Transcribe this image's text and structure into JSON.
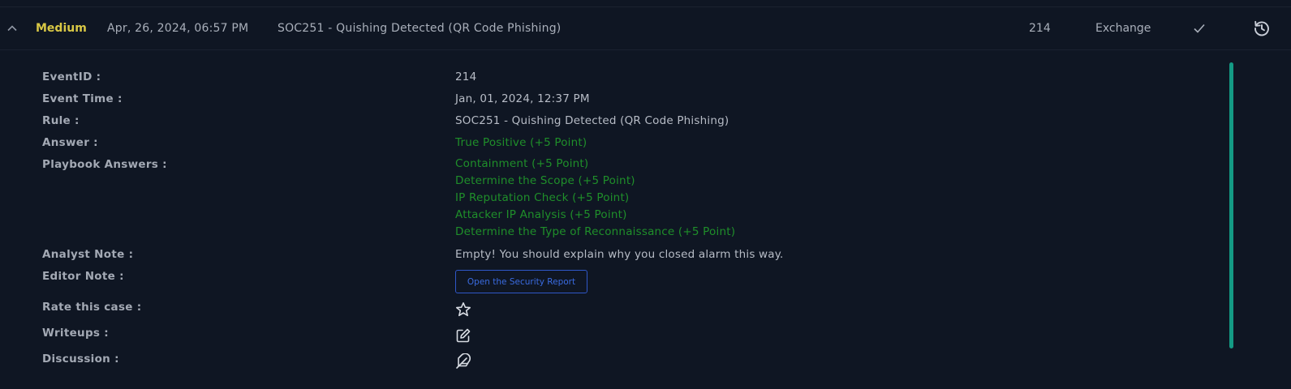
{
  "header": {
    "severity": "Medium",
    "date": "Apr, 26, 2024, 06:57 PM",
    "rule": "SOC251 - Quishing Detected (QR Code Phishing)",
    "event_id": "214",
    "source": "Exchange",
    "icons": [
      "chevron-up-icon",
      "check-icon",
      "restore-icon"
    ]
  },
  "details": {
    "labels": {
      "event_id": "EventID :",
      "event_time": "Event Time :",
      "rule": "Rule :",
      "answer": "Answer :",
      "playbook": "Playbook Answers :",
      "analyst_note": "Analyst Note :",
      "editor_note": "Editor Note :",
      "rate": "Rate this case :",
      "writeups": "Writeups :",
      "discussion": "Discussion :"
    },
    "values": {
      "event_id": "214",
      "event_time": "Jan, 01, 2024, 12:37 PM",
      "rule": "SOC251 - Quishing Detected (QR Code Phishing)",
      "answer": "True Positive (+5 Point)",
      "playbook_answers": [
        "Containment (+5 Point)",
        "Determine the Scope (+5 Point)",
        "IP Reputation Check (+5 Point)",
        "Attacker IP Analysis (+5 Point)",
        "Determine the Type of Reconnaissance (+5 Point)"
      ],
      "analyst_note": "Empty! You should explain why you closed alarm this way.",
      "editor_note_button": "Open the Security Report"
    },
    "icons": {
      "rate": "star-icon",
      "writeups": "edit-icon",
      "discussion": "feather-icon"
    }
  },
  "colors": {
    "background": "#0f1623",
    "severity_medium": "#d9c845",
    "correct_answer": "#1f8f2a",
    "link_blue": "#2f57c8",
    "scrollbar": "#149a84"
  }
}
